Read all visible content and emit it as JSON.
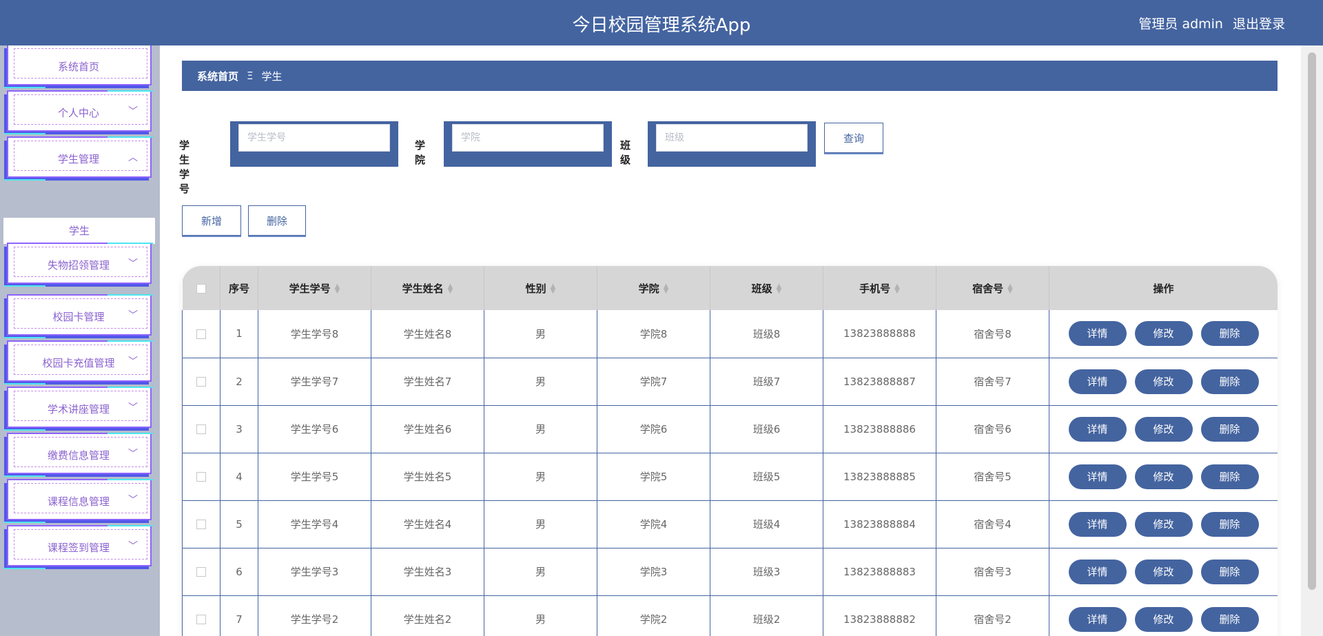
{
  "header": {
    "title": "今日校园管理系统App",
    "user_label": "管理员 admin",
    "logout_label": "退出登录"
  },
  "sidebar": {
    "items": [
      {
        "label": "系统首页",
        "chevron": ""
      },
      {
        "label": "个人中心",
        "chevron": "﹀"
      },
      {
        "label": "学生管理",
        "chevron": "︿"
      },
      {
        "label": "失物招领管理",
        "chevron": "﹀"
      },
      {
        "label": "校园卡管理",
        "chevron": "﹀"
      },
      {
        "label": "校园卡充值管理",
        "chevron": "﹀"
      },
      {
        "label": "学术讲座管理",
        "chevron": "﹀"
      },
      {
        "label": "缴费信息管理",
        "chevron": "﹀"
      },
      {
        "label": "课程信息管理",
        "chevron": "﹀"
      },
      {
        "label": "课程签到管理",
        "chevron": "﹀"
      }
    ],
    "sub_item": "学生"
  },
  "breadcrumb": {
    "home": "系统首页",
    "separator": "Ξ",
    "current": "学生"
  },
  "search": {
    "fields": [
      {
        "label": "学生学号",
        "placeholder": "学生学号"
      },
      {
        "label": "学院",
        "placeholder": "学院"
      },
      {
        "label": "班级",
        "placeholder": "班级"
      }
    ],
    "query_label": "查询"
  },
  "actions": {
    "add_label": "新增",
    "delete_label": "删除"
  },
  "table": {
    "columns": [
      "序号",
      "学生学号",
      "学生姓名",
      "性别",
      "学院",
      "班级",
      "手机号",
      "宿舍号",
      "操作"
    ],
    "rows": [
      [
        "1",
        "学生学号8",
        "学生姓名8",
        "男",
        "学院8",
        "班级8",
        "13823888888",
        "宿舍号8"
      ],
      [
        "2",
        "学生学号7",
        "学生姓名7",
        "男",
        "学院7",
        "班级7",
        "13823888887",
        "宿舍号7"
      ],
      [
        "3",
        "学生学号6",
        "学生姓名6",
        "男",
        "学院6",
        "班级6",
        "13823888886",
        "宿舍号6"
      ],
      [
        "4",
        "学生学号5",
        "学生姓名5",
        "男",
        "学院5",
        "班级5",
        "13823888885",
        "宿舍号5"
      ],
      [
        "5",
        "学生学号4",
        "学生姓名4",
        "男",
        "学院4",
        "班级4",
        "13823888884",
        "宿舍号4"
      ],
      [
        "6",
        "学生学号3",
        "学生姓名3",
        "男",
        "学院3",
        "班级3",
        "13823888883",
        "宿舍号3"
      ],
      [
        "7",
        "学生学号2",
        "学生姓名2",
        "男",
        "学院2",
        "班级2",
        "13823888882",
        "宿舍号2"
      ]
    ],
    "row_actions": [
      "详情",
      "修改",
      "删除"
    ]
  },
  "colors": {
    "primary": "#4464a0",
    "sidebar_bg": "#b6bdcc",
    "menu_text": "#8a62cf",
    "header_row": "#d6d6d6"
  }
}
